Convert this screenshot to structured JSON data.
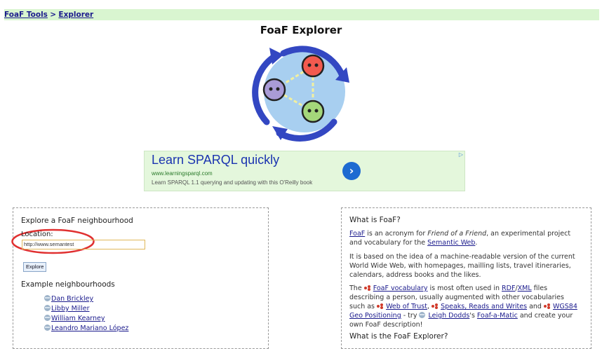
{
  "breadcrumb": {
    "root": "FoaF Tools",
    "separator": ">",
    "current": "Explorer"
  },
  "page": {
    "title": "FoaF Explorer"
  },
  "ad": {
    "title": "Learn SPARQL quickly",
    "url": "www.learningsparql.com",
    "description": "Learn SPARQL 1.1 querying and updating with this O'Reilly book",
    "go_symbol": "›",
    "info_symbol": "▷"
  },
  "explore": {
    "heading": "Explore a FoaF neighbourhood",
    "location_label": "Location:",
    "location_value": "http://www.semantest",
    "button_label": "Explore",
    "examples_heading": "Example neighbourhoods",
    "examples": [
      "Dan Brickley",
      "Libby Miller",
      "William Kearney",
      "Leandro Mariano López"
    ]
  },
  "about": {
    "heading": "What is FoaF?",
    "p1": {
      "link1": "FoaF",
      "t1": " is an acronym for ",
      "em": "Friend of a Friend",
      "t2": ", an experimental project and vocabulary for the ",
      "link2": "Semantic Web",
      "t3": "."
    },
    "p2": "It is based on the idea of a machine-readable version of the current World Wide Web, with homepages, mailling lists, travel itineraries, calendars, address books and the likes.",
    "p3": {
      "t1": "The ",
      "link_vocab": "FoaF vocabulary",
      "t2": " is most often used in ",
      "link_rdf": "RDF",
      "slash": "/",
      "link_xml": "XML",
      "t3": " files describing a person, usually augmented with other vocabularies such as ",
      "link_wot": "Web of Trust",
      "t4": ", ",
      "link_srw": "Speaks, Reads and Writes",
      "t5": " and ",
      "link_geo": "WGS84 Geo Positioning",
      "t6": " - try ",
      "link_dodds": "Leigh Dodds",
      "t7": "'s ",
      "link_matic": "Foaf-a-Matic",
      "t8": " and create your own FoaF description!"
    },
    "explorer_heading": "What is the FoaF Explorer?"
  },
  "colors": {
    "breadcrumb_bg": "#d9f5d0",
    "logo_circle": "#a8cff0",
    "logo_arrows": "#3347c2",
    "node_red": "#f25a4f",
    "node_purple": "#a99bd6",
    "node_green": "#a4d77a",
    "highlight_ring": "#e03030"
  }
}
